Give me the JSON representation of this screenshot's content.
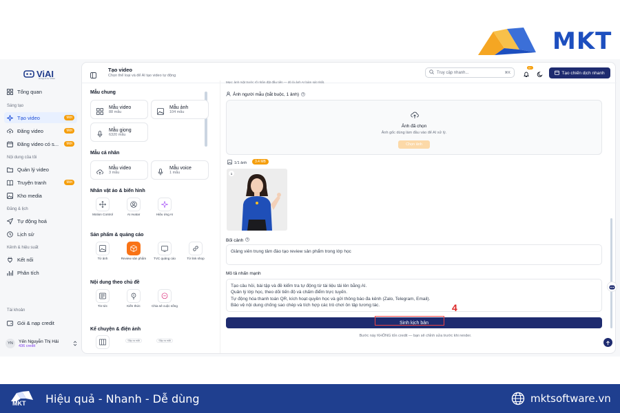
{
  "brand": {
    "name": "MKT"
  },
  "sidebar": {
    "logo": "ViAI",
    "logo_sub": "AI Agent for Video",
    "dashboard": "Tổng quan",
    "section_create": "Sáng tạo",
    "create_video": "Tạo video",
    "upload_video": "Đăng video",
    "upload_video_many": "Đăng video có s...",
    "badge_new": "Mới",
    "section_mine": "Nội dung của tôi",
    "manage_video": "Quản lý video",
    "comics": "Truyện tranh",
    "media": "Kho media",
    "section_schedule": "Đăng & lịch",
    "automation": "Tự động hoá",
    "history": "Lịch sử",
    "section_channel": "Kênh & hiệu suất",
    "connect": "Kết nối",
    "analytics": "Phân tích",
    "section_account": "Tài khoản",
    "plans": "Gói & nạp credit",
    "user_initials": "YN",
    "user_name": "Yến Nguyễn Thị Hải",
    "user_credit": "436 credit"
  },
  "topbar": {
    "title": "Tạo video",
    "subtitle": "Chọn thể loại và để AI tạo video tự động",
    "search_placeholder": "Truy cập nhanh...",
    "search_kbd": "⌘K",
    "bell_badge": "9+",
    "cta": "Tạo chiến dịch nhanh"
  },
  "templates": {
    "common_heading": "Mẫu chung",
    "video_title": "Mẫu video",
    "video_count": "88 mẫu",
    "image_title": "Mẫu ảnh",
    "image_count": "104 mẫu",
    "voice_title": "Mẫu giọng",
    "voice_count": "6320 mẫu",
    "personal_heading": "Mẫu cá nhân",
    "p_video_title": "Mẫu video",
    "p_video_count": "3 mẫu",
    "p_voice_title": "Mẫu voice",
    "p_voice_count": "1 mẫu",
    "avatar_heading": "Nhân vật ảo & biến hình",
    "motion": "Motion Control",
    "ai_avatar": "AI Avatar",
    "ai_effect": "Hiệu ứng AI",
    "product_heading": "Sản phẩm & quảng cáo",
    "from_image": "Từ ảnh",
    "review_product": "Review sản phẩm",
    "tvc": "TVC quảng cáo",
    "from_link": "Từ link shop",
    "topic_heading": "Nội dung theo chủ đề",
    "news": "Tin tức",
    "knowledge": "Kiến thức",
    "life_share": "Chia sẻ cuộc sống",
    "story_heading": "Kể chuyện & điện ảnh",
    "tag_new_a": "Sắp ra mắt",
    "tag_new_b": "Sắp ra mắt"
  },
  "content": {
    "note": "Mẹo: ảnh mặt trước rõ nhân đặt đầu tiên — đó là ảnh AI bám sát nhất.",
    "model_label": "Ảnh người mẫu (bắt buộc, 1 ảnh)",
    "upload_title": "Ảnh đã chọn",
    "upload_hint": "Ảnh gốc dùng làm đầu vào để AI xử lý.",
    "upload_button": "Chọn ảnh",
    "image_count": "1/1 ảnh",
    "image_size": "3.4 MB",
    "person_index": "1",
    "context_label": "Bối cảnh",
    "context_value": "Giảng viên trung tâm đào tạo review sản phẩm trong lớp học",
    "emphasis_label": "Mô tả nhấn mạnh",
    "emphasis_lines": [
      "Tạo câu hỏi, bài tập và đề kiểm tra tự động từ tài liệu tải lên bằng AI.",
      "Quản lý lớp học, theo dõi tiến độ và chấm điểm trực tuyến.",
      "Tự động hóa thanh toán QR, kích hoạt quyền học và gửi thông báo đa kênh (Zalo, Telegram, Email).",
      "Bảo vệ nội dung chống sao chép và tích hợp các trò chơi ôn tập tương tác."
    ],
    "generate_button": "Sinh kịch bản",
    "step_number": "4",
    "footnote": "Bước này KHÔNG tốn credit — bạn sẽ chỉnh sửa trước khi render."
  },
  "banner": {
    "logo": "MKT",
    "slogan": "Hiệu quả - Nhanh - Dễ dùng",
    "site": "mktsoftware.vn"
  },
  "colors": {
    "primary": "#1e2b6f",
    "accent": "#f59e0b",
    "banner": "#1f3f8f",
    "highlight": "#ef4444"
  }
}
